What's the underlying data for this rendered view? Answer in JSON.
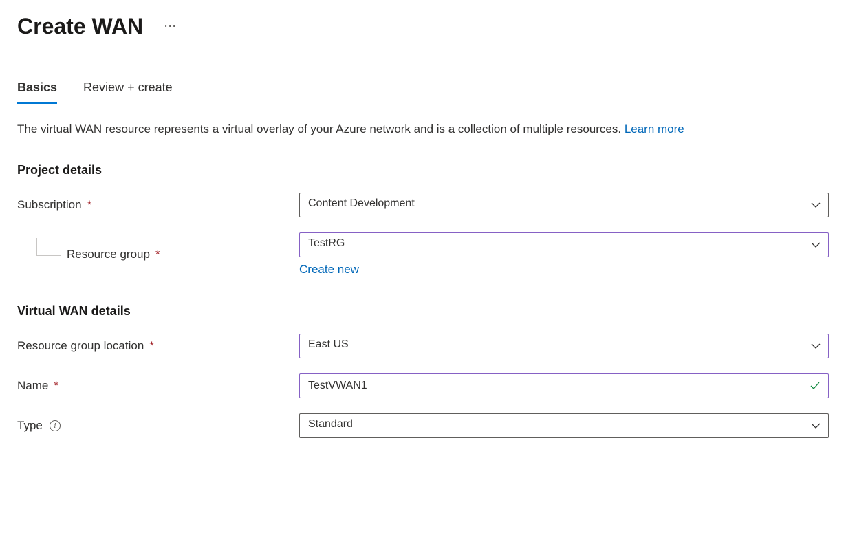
{
  "header": {
    "title": "Create WAN"
  },
  "tabs": {
    "basics": "Basics",
    "review_create": "Review + create"
  },
  "description": {
    "text": "The virtual WAN resource represents a virtual overlay of your Azure network and is a collection of multiple resources.  ",
    "link": "Learn more"
  },
  "sections": {
    "project_details": {
      "title": "Project details",
      "subscription": {
        "label": "Subscription",
        "value": "Content Development"
      },
      "resource_group": {
        "label": "Resource group",
        "value": "TestRG",
        "create_new": "Create new"
      }
    },
    "vwan_details": {
      "title": "Virtual WAN details",
      "location": {
        "label": "Resource group location",
        "value": "East US"
      },
      "name": {
        "label": "Name",
        "value": "TestVWAN1"
      },
      "type": {
        "label": "Type",
        "value": "Standard"
      }
    }
  }
}
